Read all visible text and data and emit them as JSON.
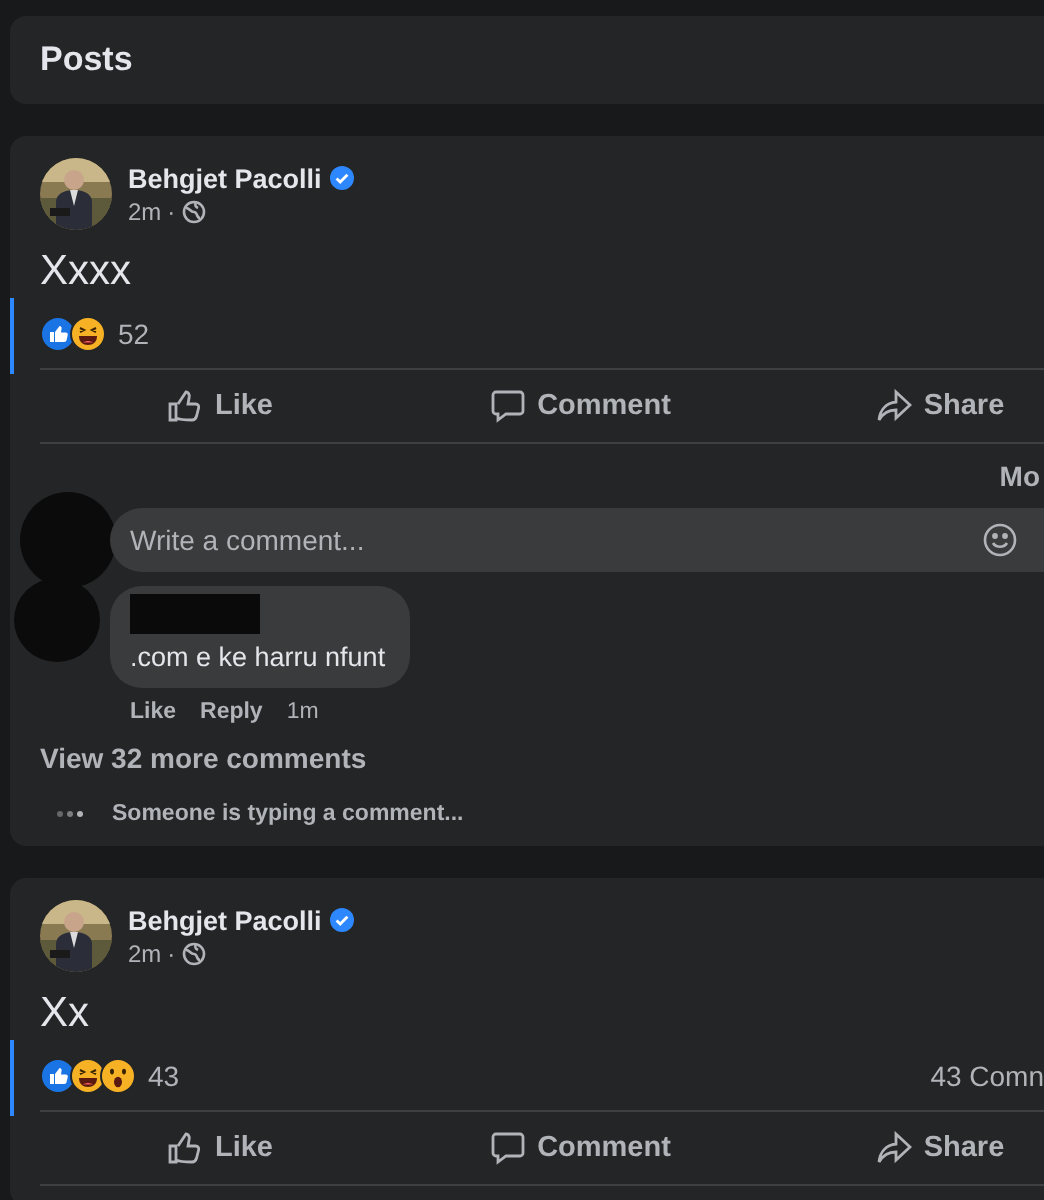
{
  "header": {
    "title": "Posts"
  },
  "posts": [
    {
      "author": "Behgjet Pacolli",
      "verified": true,
      "time": "2m",
      "separator": "·",
      "text": "Xxxx",
      "reactions": [
        {
          "kind": "like"
        },
        {
          "kind": "haha"
        }
      ],
      "reaction_count": "52",
      "actions": [
        "Like",
        "Comment",
        "Share"
      ],
      "sort_label": "Mo",
      "comment_box": {
        "placeholder": "Write a comment..."
      },
      "comments": [
        {
          "text": ".com e ke harru nfunt",
          "actions": [
            "Like",
            "Reply"
          ],
          "time": "1m"
        }
      ],
      "view_more": "View 32 more comments",
      "typing": "Someone is typing a comment..."
    },
    {
      "author": "Behgjet Pacolli",
      "verified": true,
      "time": "2m",
      "separator": "·",
      "text": "Xx",
      "reactions": [
        {
          "kind": "like"
        },
        {
          "kind": "haha"
        },
        {
          "kind": "wow"
        }
      ],
      "reaction_count": "43",
      "comment_count": "43 Comn",
      "actions": [
        "Like",
        "Comment",
        "Share"
      ]
    }
  ]
}
